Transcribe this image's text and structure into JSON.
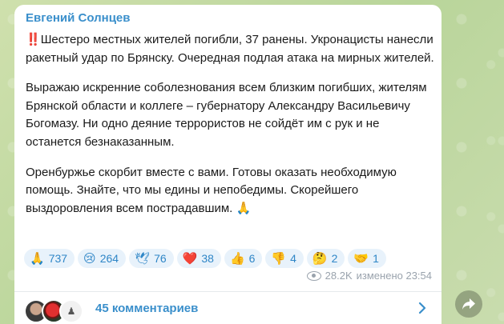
{
  "post": {
    "author": "Евгений Солнцев",
    "paragraphs": [
      "Шестеро местных жителей погибли, 37 ранены. Укронацисты нанесли ракетный удар по Брянску. Очередная подлая атака на мирных жителей.",
      "Выражаю искренние соболезнования всем близким погибших, жителям Брянской области и коллеге – губернатору Александру Васильевичу Богомазу. Ни одно деяние террористов не сойдёт им с рук и не останется безнаказанным.",
      "Оренбуржье скорбит вместе с вами. Готовы оказать необходимую помощь. Знайте, что мы едины и непобедимы. Скорейшего выздоровления всем пострадавшим. 🙏"
    ],
    "prefix_emoji": "‼️",
    "reactions": [
      {
        "emoji": "🙏",
        "count": "737"
      },
      {
        "emoji": "😢",
        "count": "264"
      },
      {
        "emoji": "🕊",
        "count": "76"
      },
      {
        "emoji": "❤️",
        "count": "38"
      },
      {
        "emoji": "👍",
        "count": "6"
      },
      {
        "emoji": "👎",
        "count": "4"
      },
      {
        "emoji": "🤔",
        "count": "2"
      },
      {
        "emoji": "🤝",
        "count": "1"
      }
    ],
    "views": "28.2K",
    "edited_time": "изменено 23:54",
    "comments_label": "45 комментариев"
  },
  "colors": {
    "accent": "#3a8fcb",
    "background": "#c5d9a8"
  }
}
